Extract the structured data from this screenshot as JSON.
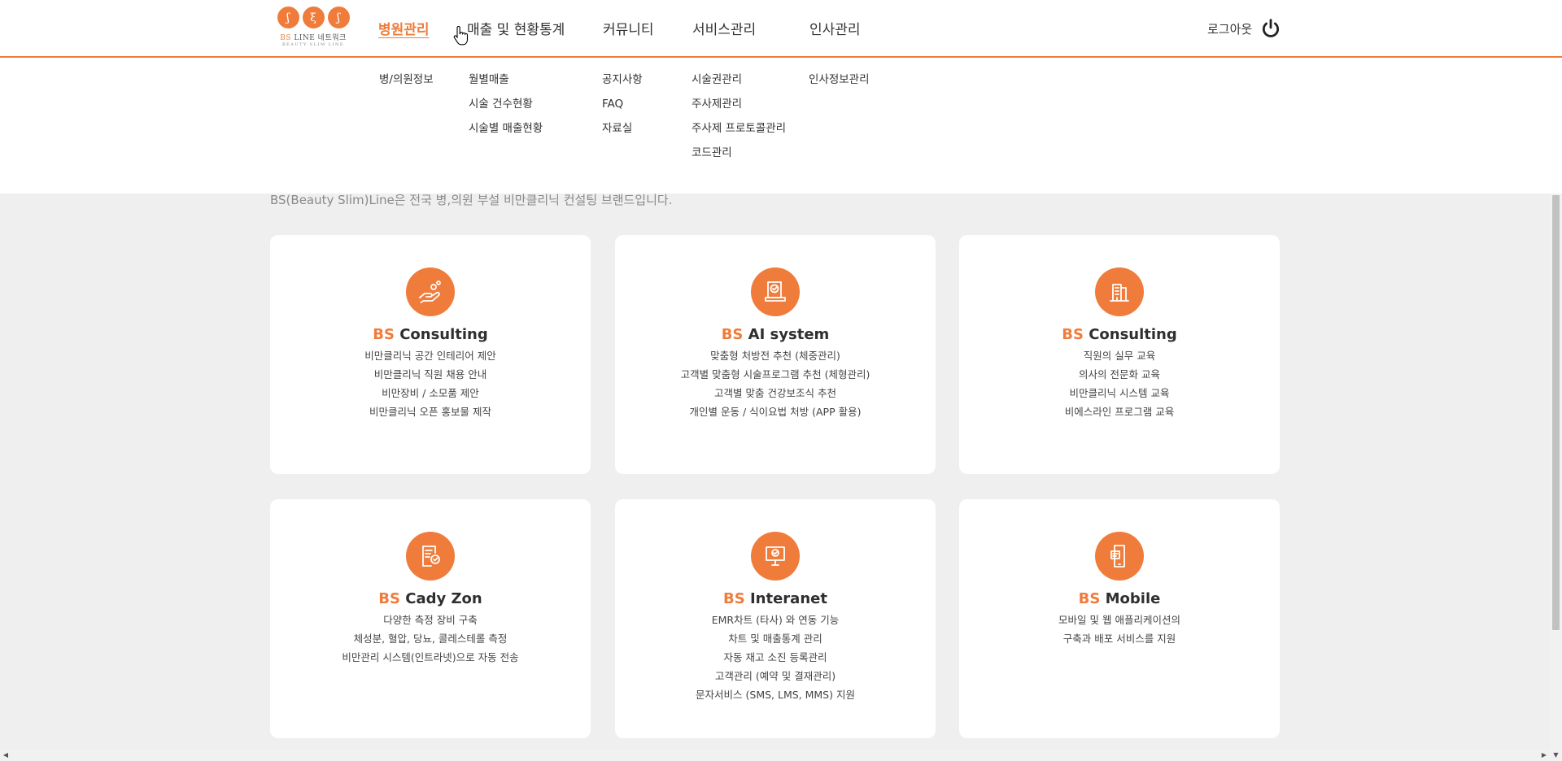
{
  "header": {
    "logo": {
      "circles": [
        "ʃ",
        "ξ",
        "ʃ"
      ],
      "brand_bs": "BS",
      "brand_rest": " LINE 네트워크",
      "tagline": "BEAUTY SLIM LINE"
    },
    "nav": [
      {
        "label": "병원관리",
        "active": true
      },
      {
        "label": "매출 및 현황통계"
      },
      {
        "label": "커뮤니티"
      },
      {
        "label": "서비스관리"
      },
      {
        "label": "인사관리"
      }
    ],
    "logout_label": "로그아웃"
  },
  "dropdown": {
    "columns": [
      [
        "병/의원정보"
      ],
      [
        "월별매출",
        "시술 건수현황",
        "시술별 매출현황"
      ],
      [
        "공지사항",
        "FAQ",
        "자료실"
      ],
      [
        "시술권관리",
        "주사제관리",
        "주사제 프로토콜관리",
        "코드관리"
      ],
      [
        "인사정보관리"
      ]
    ]
  },
  "intro": "BS(Beauty Slim)Line은 전국 병,의원 부설 비만클리닉 컨설팅 브랜드입니다.",
  "cards": [
    {
      "bs": "BS",
      "title": " Consulting",
      "icon": "hand-coins-icon",
      "lines": [
        "비만클리닉 공간 인테리어 제안",
        "비만클리닉 직원 채용 안내",
        "비만장비 / 소모품 제안",
        "비만클리닉 오픈 홍보물 제작"
      ]
    },
    {
      "bs": "BS",
      "title": " AI system",
      "icon": "document-check-icon",
      "lines": [
        "맞춤형 처방전 추천 (체중관리)",
        "고객별 맞춤형 시술프로그램 추천 (체형관리)",
        "고객별 맞춤 건강보조식 추천",
        "개인별 운동 / 식이요법 처방 (APP 활용)"
      ]
    },
    {
      "bs": "BS",
      "title": " Consulting",
      "icon": "building-icon",
      "lines": [
        "직원의 실무 교육",
        "의사의 전문화 교육",
        "비만클리닉 시스템 교육",
        "비에스라인 프로그램 교육"
      ]
    },
    {
      "bs": "BS",
      "title": " Cady Zon",
      "icon": "checklist-icon",
      "lines": [
        "다양한 측정 장비 구축",
        "체성분, 혈압, 당뇨, 콜레스테롤 측정",
        "비만관리 시스템(인트라넷)으로 자동 전송"
      ]
    },
    {
      "bs": "BS",
      "title": " Interanet",
      "icon": "monitor-check-icon",
      "lines": [
        "EMR차트 (타사) 와 연동 기능",
        "차트 및 매출통계 관리",
        "자동 재고 소진 등록관리",
        "고객관리 (예약 및 결재관리)",
        "문자서비스 (SMS, LMS, MMS) 지원"
      ]
    },
    {
      "bs": "BS",
      "title": " Mobile",
      "icon": "mobile-icon",
      "lines": [
        "모바일 및 웹 애플리케이션의",
        "구축과 배포 서비스를 지원"
      ]
    }
  ]
}
